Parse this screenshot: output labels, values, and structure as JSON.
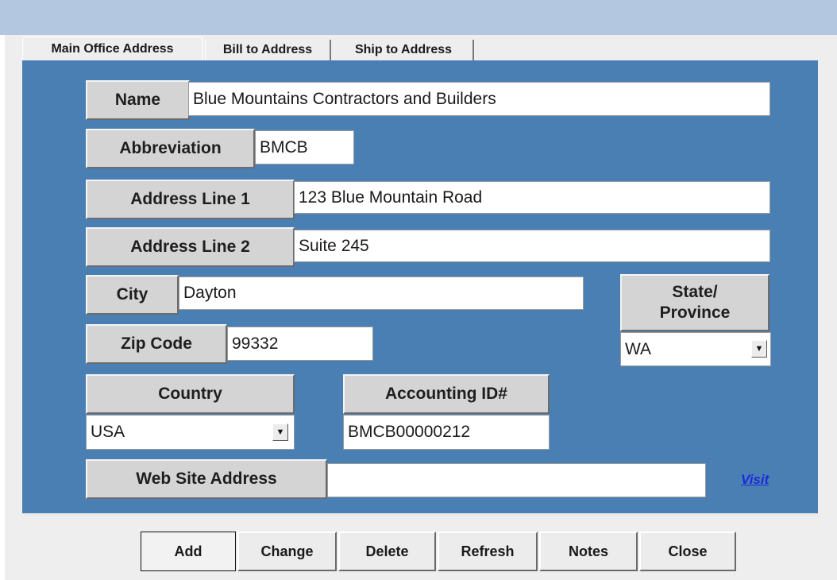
{
  "tabs": [
    {
      "label": "Main Office Address"
    },
    {
      "label": "Bill to Address"
    },
    {
      "label": "Ship to Address"
    }
  ],
  "fields": {
    "name": {
      "label": "Name",
      "value": "Blue Mountains Contractors and Builders"
    },
    "abbreviation": {
      "label": "Abbreviation",
      "value": "BMCB"
    },
    "address_line_1": {
      "label": "Address Line 1",
      "value": "123 Blue Mountain Road"
    },
    "address_line_2": {
      "label": "Address Line 2",
      "value": "Suite 245"
    },
    "city": {
      "label": "City",
      "value": "Dayton"
    },
    "state": {
      "label_line1": "State/",
      "label_line2": "Province",
      "value": "WA"
    },
    "zip": {
      "label": "Zip Code",
      "value": "99332"
    },
    "country": {
      "label": "Country",
      "value": "USA"
    },
    "accounting_id": {
      "label": "Accounting ID#",
      "value": "BMCB00000212"
    },
    "website": {
      "label": "Web Site Address",
      "value": "",
      "link_label": "Visit"
    }
  },
  "buttons": {
    "add": "Add",
    "change": "Change",
    "delete": "Delete",
    "refresh": "Refresh",
    "notes": "Notes",
    "close": "Close"
  },
  "icons": {
    "dropdown": "chevron-down-icon"
  },
  "colors": {
    "panel": "#4a7fb3",
    "label_bg": "#d4d4d4",
    "link": "#1a2bd9"
  }
}
